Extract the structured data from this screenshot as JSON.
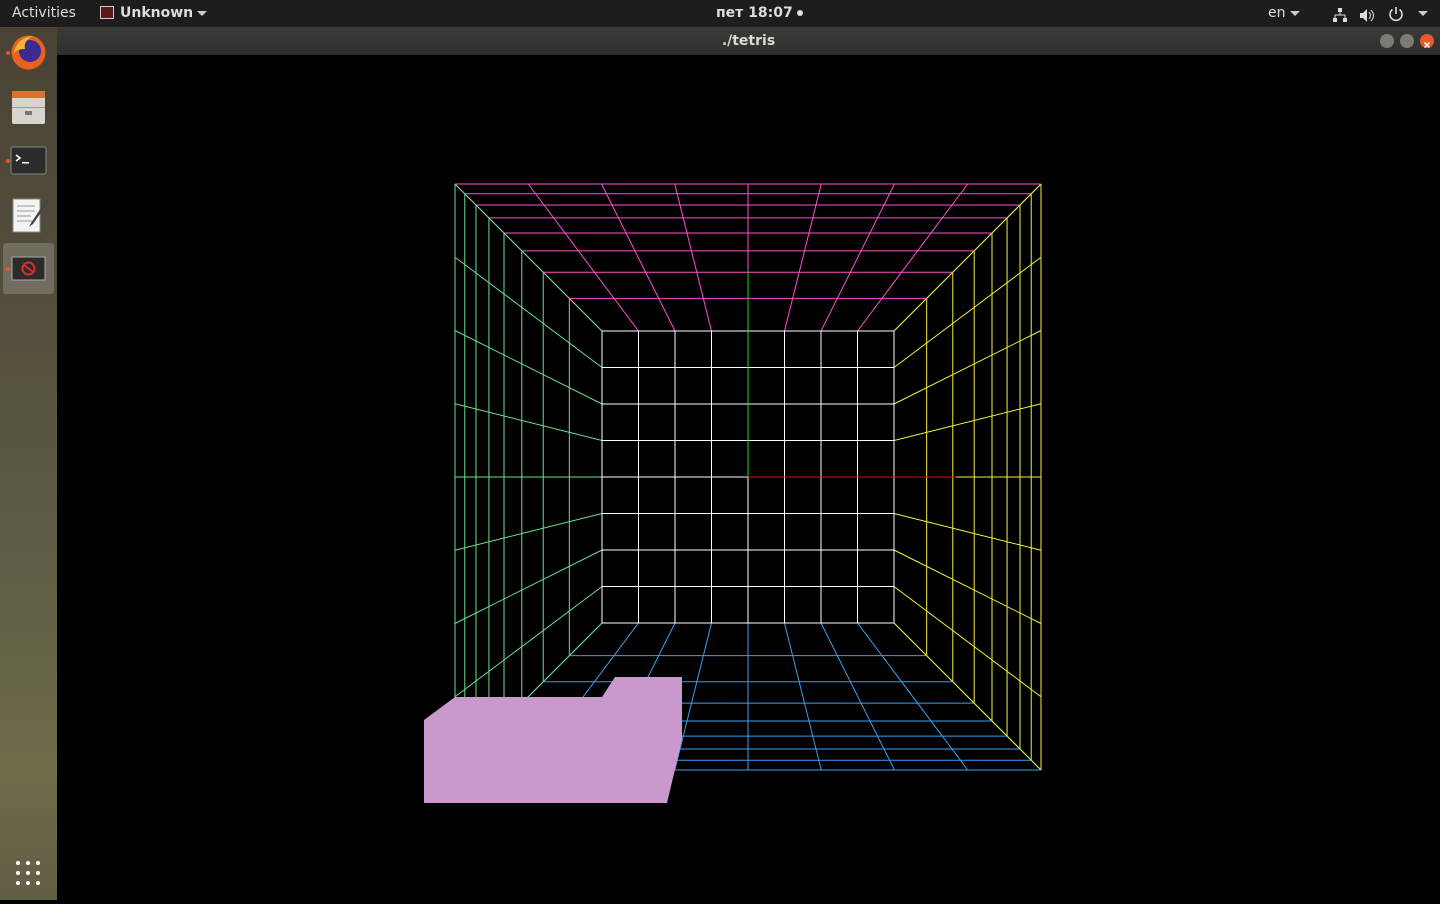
{
  "topbar": {
    "activities": "Activities",
    "app_name": "Unknown",
    "clock": "пет 18:07",
    "language": "en"
  },
  "window": {
    "title": "./tetris"
  },
  "dock": {
    "items": [
      "firefox",
      "files",
      "terminal",
      "text-editor",
      "tetris-app"
    ]
  },
  "scene": {
    "grid_columns": 8,
    "grid_rows": 8,
    "depth_layers": 8,
    "colors": {
      "back_wall": "#ffffff",
      "ceiling": "#ff4fd0",
      "floor": "#3c9ff0",
      "left_wall": "#6ce08f",
      "right_wall": "#f2f23a",
      "x_axis": "#e01010",
      "y_axis": "#10e010",
      "falling_piece": "#c999cd"
    }
  }
}
